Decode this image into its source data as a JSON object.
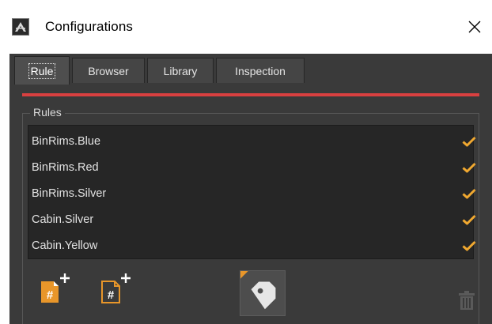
{
  "window": {
    "title": "Configurations",
    "icons": {
      "app": "app-logo-icon",
      "close": "close-icon"
    }
  },
  "tabs": [
    {
      "label": "Rule",
      "active": true
    },
    {
      "label": "Browser",
      "active": false
    },
    {
      "label": "Library",
      "active": false
    },
    {
      "label": "Inspection",
      "active": false
    }
  ],
  "accent_color": "#d94040",
  "check_color": "#f0a830",
  "rules": {
    "group_label": "Rules",
    "items": [
      {
        "name": "BinRims.Blue",
        "enabled": true
      },
      {
        "name": "BinRims.Red",
        "enabled": true
      },
      {
        "name": "BinRims.Silver",
        "enabled": true
      },
      {
        "name": "Cabin.Silver",
        "enabled": true
      },
      {
        "name": "Cabin.Yellow",
        "enabled": true
      }
    ]
  },
  "toolbar": {
    "buttons": [
      {
        "name": "add-rule-button",
        "icon": "add-hash-document-icon"
      },
      {
        "name": "add-rule-outline-button",
        "icon": "add-hash-document-outline-icon"
      },
      {
        "name": "tag-button",
        "icon": "tag-icon"
      },
      {
        "name": "delete-button",
        "icon": "trash-icon"
      }
    ]
  }
}
